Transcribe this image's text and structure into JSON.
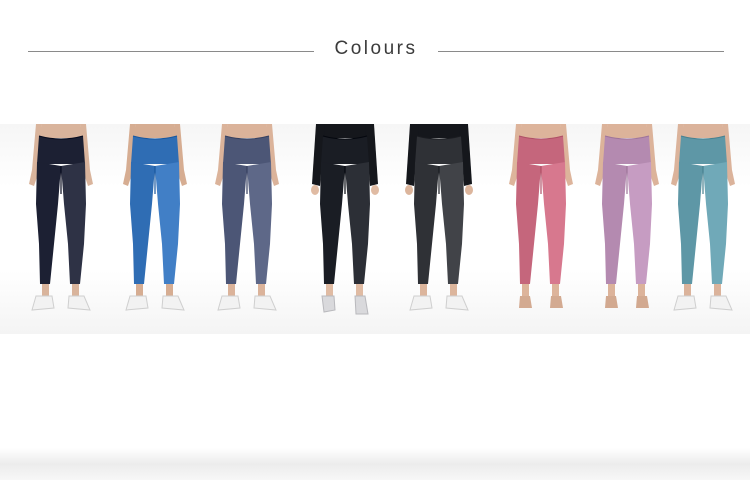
{
  "header": {
    "title": "Colours"
  },
  "colours": [
    {
      "fabric": "#1c2033",
      "skin": "#d9b49c",
      "top": "skin",
      "shoe": "sneaker"
    },
    {
      "fabric": "#2f6db4",
      "skin": "#d6ad92",
      "top": "skin",
      "shoe": "sneaker"
    },
    {
      "fabric": "#4c5676",
      "skin": "#dbb39a",
      "top": "skin",
      "shoe": "sneaker"
    },
    {
      "fabric": "#1a1d24",
      "skin": "#e0bba3",
      "top": "black",
      "shoe": "flat"
    },
    {
      "fabric": "#2f3136",
      "skin": "#dcb59c",
      "top": "black",
      "shoe": "sneaker"
    },
    {
      "fabric": "#c5667c",
      "skin": "#ddb49b",
      "top": "skin",
      "shoe": "barefoot"
    },
    {
      "fabric": "#b48ab0",
      "skin": "#dcb39a",
      "top": "skin",
      "shoe": "barefoot"
    },
    {
      "fabric": "#5e97a6",
      "skin": "#dbb39b",
      "top": "skin",
      "shoe": "sneaker"
    }
  ]
}
